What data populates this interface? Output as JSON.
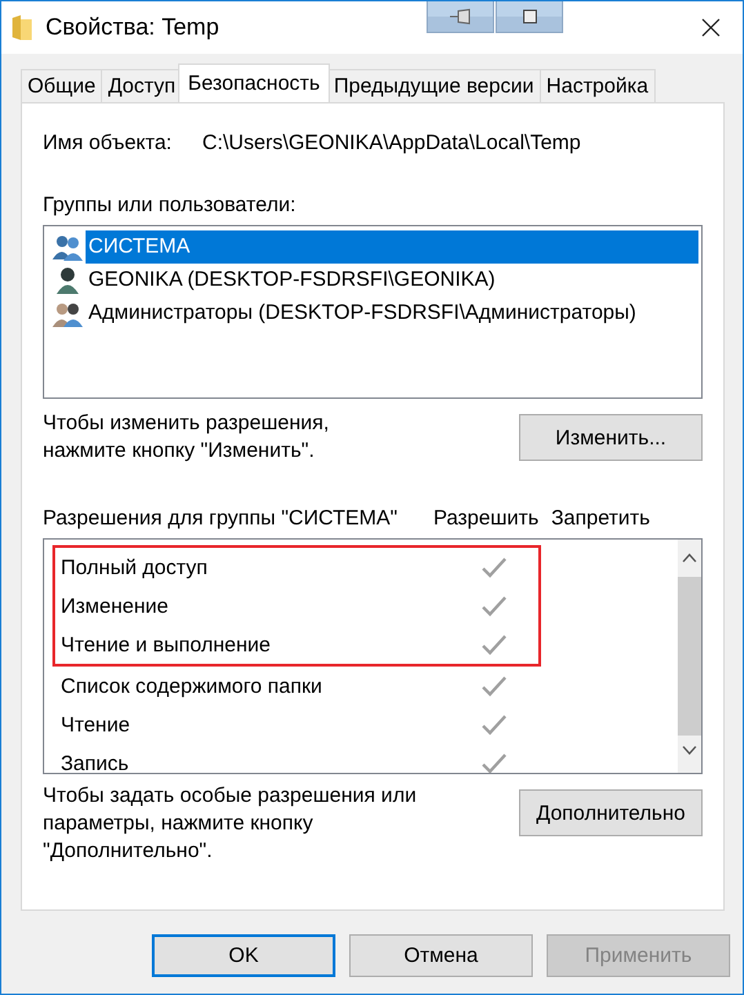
{
  "window": {
    "title": "Свойства: Temp"
  },
  "tabs": [
    {
      "label": "Общие",
      "selected": false
    },
    {
      "label": "Доступ",
      "selected": false
    },
    {
      "label": "Безопасность",
      "selected": true
    },
    {
      "label": "Предыдущие версии",
      "selected": false
    },
    {
      "label": "Настройка",
      "selected": false
    }
  ],
  "object_name": {
    "label": "Имя объекта:",
    "value": "C:\\Users\\GEONIKA\\AppData\\Local\\Temp"
  },
  "groups": {
    "label": "Группы или пользователи:",
    "items": [
      {
        "kind": "system",
        "name": "СИСТЕМА",
        "selected": true
      },
      {
        "kind": "user",
        "name": "GEONIKA (DESKTOP-FSDRSFI\\GEONIKA)",
        "selected": false
      },
      {
        "kind": "admins",
        "name": "Администраторы (DESKTOP-FSDRSFI\\Администраторы)",
        "selected": false
      }
    ]
  },
  "change_hint": "Чтобы изменить разрешения,\nнажмите кнопку \"Изменить\".",
  "change_button": "Изменить...",
  "permissions": {
    "label": "Разрешения для группы \"СИСТЕМА\"",
    "allow_header": "Разрешить",
    "deny_header": "Запретить",
    "rows": [
      {
        "name": "Полный доступ",
        "allow": true,
        "deny": false,
        "highlighted": true
      },
      {
        "name": "Изменение",
        "allow": true,
        "deny": false,
        "highlighted": true
      },
      {
        "name": "Чтение и выполнение",
        "allow": true,
        "deny": false,
        "highlighted": true
      },
      {
        "name": "Список содержимого папки",
        "allow": true,
        "deny": false,
        "highlighted": false
      },
      {
        "name": "Чтение",
        "allow": true,
        "deny": false,
        "highlighted": false
      },
      {
        "name": "Запись",
        "allow": true,
        "deny": false,
        "highlighted": false
      }
    ]
  },
  "advanced_hint": "Чтобы задать особые разрешения или\nпараметры, нажмите кнопку\n\"Дополнительно\".",
  "advanced_button": "Дополнительно",
  "buttons": [
    {
      "label": "OK",
      "default": true,
      "disabled": false
    },
    {
      "label": "Отмена",
      "default": false,
      "disabled": false
    },
    {
      "label": "Применить",
      "default": false,
      "disabled": true
    }
  ]
}
